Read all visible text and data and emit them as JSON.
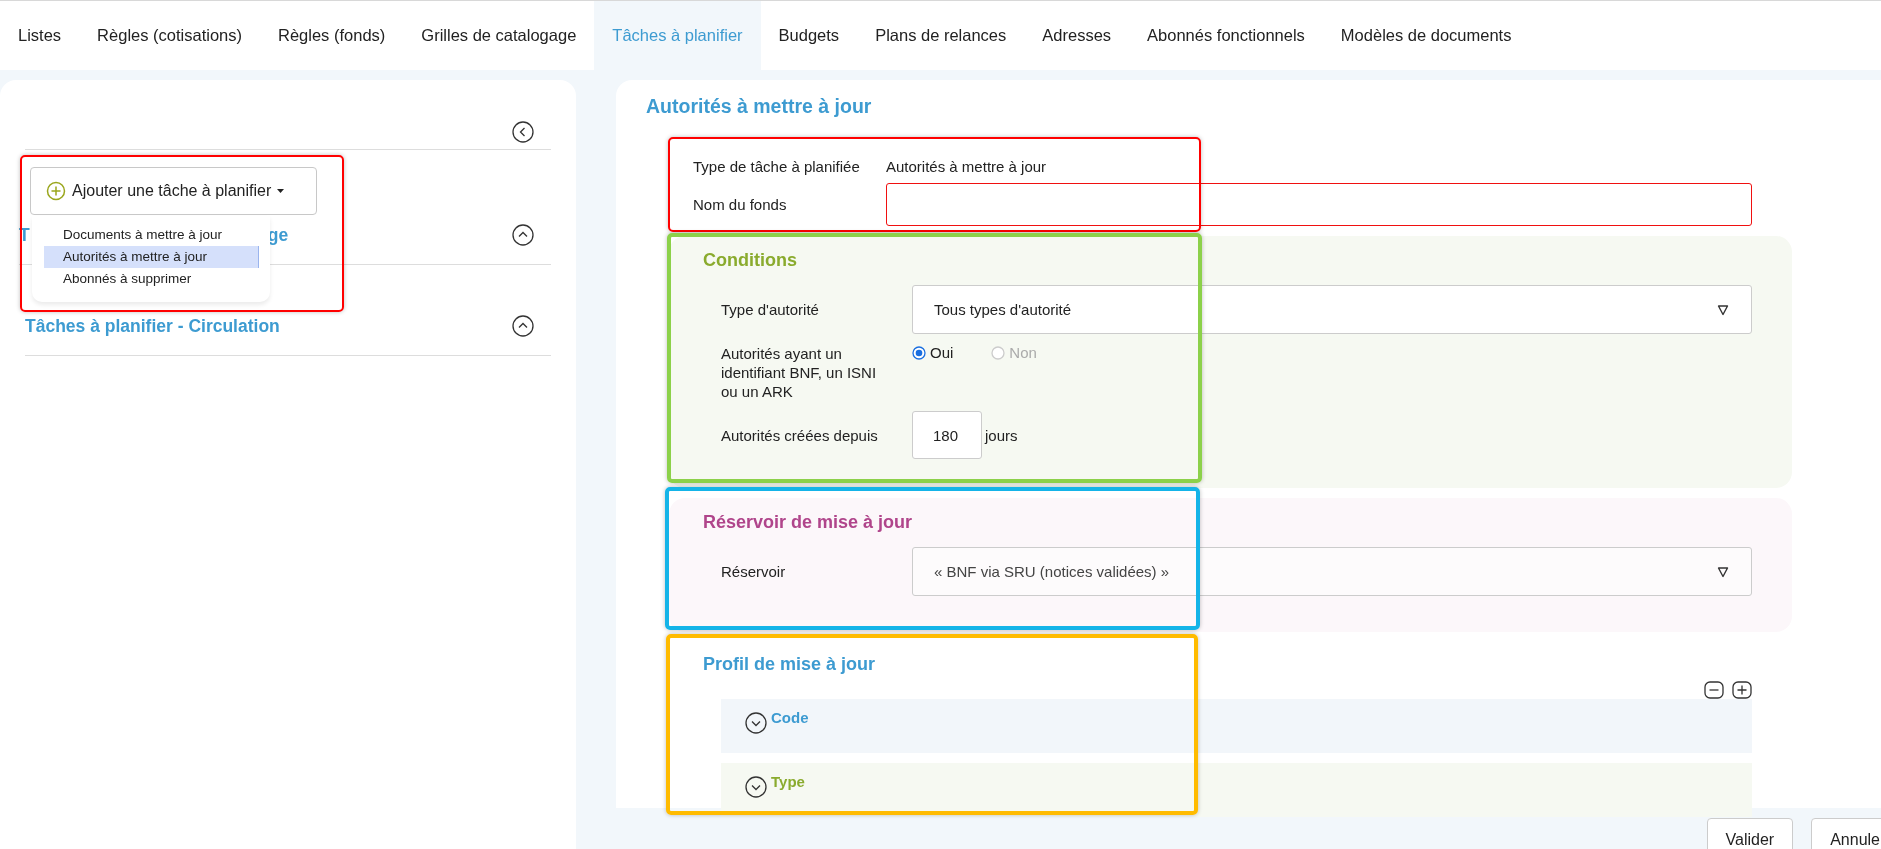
{
  "tabs": [
    {
      "label": "Listes",
      "selected": false
    },
    {
      "label": "Règles (cotisations)",
      "selected": false
    },
    {
      "label": "Règles (fonds)",
      "selected": false
    },
    {
      "label": "Grilles de catalogage",
      "selected": false
    },
    {
      "label": "Tâches à planifier",
      "selected": true
    },
    {
      "label": "Budgets",
      "selected": false
    },
    {
      "label": "Plans de relances",
      "selected": false
    },
    {
      "label": "Adresses",
      "selected": false
    },
    {
      "label": "Abonnés fonctionnels",
      "selected": false
    },
    {
      "label": "Modèles de documents",
      "selected": false
    }
  ],
  "sidebar": {
    "sections": [
      {
        "title_parts": [
          "T",
          "ge"
        ],
        "expanded": true
      },
      {
        "title_parts": [
          "Tâches à planifier - Circulation"
        ],
        "expanded": true
      }
    ],
    "add_button": {
      "label": "Ajouter une tâche à planifier"
    },
    "add_menu": [
      {
        "label": "Documents à mettre à jour",
        "selected": false
      },
      {
        "label": "Autorités à mettre à jour",
        "selected": true
      },
      {
        "label": "Abonnés à supprimer",
        "selected": false
      }
    ]
  },
  "form": {
    "title": "Autorités à mettre à jour",
    "task_type": {
      "label": "Type de tâche à planifiée",
      "value": "Autorités à mettre à jour"
    },
    "fund_name": {
      "label": "Nom du fonds",
      "invalid": true
    },
    "conditions": {
      "title": "Conditions",
      "authority_type": {
        "label": "Type d'autorité",
        "value": "Tous types d'autorité"
      },
      "identifier": {
        "label": "Autorités ayant un identifiant BNF, un ISNI ou un ARK",
        "options": [
          {
            "label": "Oui",
            "selected": true,
            "disabled": false
          },
          {
            "label": "Non",
            "selected": false,
            "disabled": true
          }
        ]
      },
      "created_since": {
        "label": "Autorités créées depuis",
        "value": "180",
        "unit": "jours"
      }
    },
    "reservoir": {
      "title": "Réservoir de mise à jour",
      "field": {
        "label": "Réservoir",
        "value": "« BNF via SRU (notices validées) »"
      }
    },
    "profile": {
      "title": "Profil de mise à jour",
      "groups": [
        {
          "label": "Code",
          "color": "#3d9bd1",
          "expanded": false
        },
        {
          "label": "Type",
          "color": "#8aab2e",
          "expanded": false
        }
      ]
    }
  },
  "buttons": [
    "Valider",
    "Annule"
  ],
  "annotation_frames": [
    {
      "color": "#ff0000"
    },
    {
      "color": "#ff0000"
    },
    {
      "color": "#8cd14a"
    },
    {
      "color": "#14b4e8"
    },
    {
      "color": "#ffbb00"
    }
  ]
}
